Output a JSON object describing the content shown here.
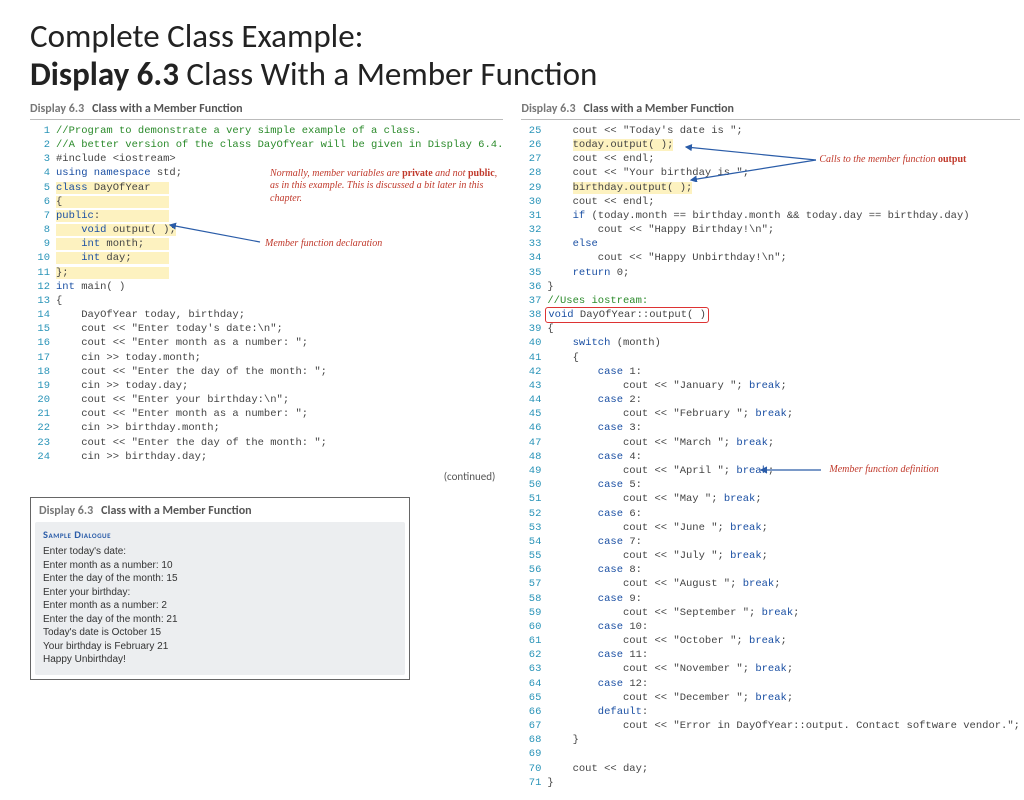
{
  "title_line1": "Complete Class Example:",
  "title_bold": "Display 6.3",
  "title_line2": "  Class With a Member Function",
  "caption_disp": "Display 6.3",
  "caption_text": "Class with a Member Function",
  "continued": "(continued)",
  "annotations": {
    "private_note_1": "Normally, member variables are ",
    "private_note_kw1": "private",
    "private_note_2": " and\nnot ",
    "private_note_kw2": "public",
    "private_note_3": ", as in this example. This is\ndiscussed a bit later in this chapter.",
    "decl": "Member function declaration",
    "calls_1": "Calls to the member function ",
    "calls_kw": "output",
    "defn": "Member function definition"
  },
  "code_left": [
    {
      "n": 1,
      "t": "//Program to demonstrate a very simple example of a class.",
      "cls": "cm"
    },
    {
      "n": 2,
      "t": "//A better version of the class DayOfYear will be given in Display 6.4.",
      "cls": "cm"
    },
    {
      "n": 3,
      "html": "<span class='txt'>#include &lt;iostream&gt;</span>"
    },
    {
      "n": 4,
      "html": "<span class='kw'>using namespace</span><span class='txt'> std;</span>"
    },
    {
      "n": 5,
      "html": "<span class='hl-yellow'><span class='kw'>class</span><span class='txt'> DayOfYear   </span></span>"
    },
    {
      "n": 6,
      "html": "<span class='hl-yellow'><span class='txt'>{                 </span></span>"
    },
    {
      "n": 7,
      "html": "<span class='hl-yellow'><span class='kw'>public</span><span class='txt'>:           </span></span>"
    },
    {
      "n": 8,
      "html": "<span class='hl-yellow'><span class='txt'>    </span><span class='kw'>void</span><span class='txt'> output( );</span></span>"
    },
    {
      "n": 9,
      "html": "<span class='hl-yellow'><span class='txt'>    </span><span class='kw'>int</span><span class='txt'> month;    </span></span>"
    },
    {
      "n": 10,
      "html": "<span class='hl-yellow'><span class='txt'>    </span><span class='kw'>int</span><span class='txt'> day;      </span></span>"
    },
    {
      "n": 11,
      "html": "<span class='hl-yellow'><span class='txt'>};                </span></span>"
    },
    {
      "n": 12,
      "html": "<span class='kw'>int</span><span class='txt'> main( )</span>"
    },
    {
      "n": 13,
      "t": "{",
      "cls": "txt"
    },
    {
      "n": 14,
      "t": "    DayOfYear today, birthday;",
      "cls": "txt"
    },
    {
      "n": 15,
      "t": "    cout << \"Enter today's date:\\n\";",
      "cls": "txt"
    },
    {
      "n": 16,
      "t": "    cout << \"Enter month as a number: \";",
      "cls": "txt"
    },
    {
      "n": 17,
      "t": "    cin >> today.month;",
      "cls": "txt"
    },
    {
      "n": 18,
      "t": "    cout << \"Enter the day of the month: \";",
      "cls": "txt"
    },
    {
      "n": 19,
      "t": "    cin >> today.day;",
      "cls": "txt"
    },
    {
      "n": 20,
      "t": "    cout << \"Enter your birthday:\\n\";",
      "cls": "txt"
    },
    {
      "n": 21,
      "t": "    cout << \"Enter month as a number: \";",
      "cls": "txt"
    },
    {
      "n": 22,
      "t": "    cin >> birthday.month;",
      "cls": "txt"
    },
    {
      "n": 23,
      "t": "    cout << \"Enter the day of the month: \";",
      "cls": "txt"
    },
    {
      "n": 24,
      "t": "    cin >> birthday.day;",
      "cls": "txt"
    }
  ],
  "code_right": [
    {
      "n": 25,
      "t": "    cout << \"Today's date is \";",
      "cls": "txt"
    },
    {
      "n": 26,
      "html": "<span class='txt'>    </span><span class='hl-yellow txt'>today.output( );</span>"
    },
    {
      "n": 27,
      "t": "    cout << endl;",
      "cls": "txt"
    },
    {
      "n": 28,
      "t": "    cout << \"Your birthday is \";",
      "cls": "txt"
    },
    {
      "n": 29,
      "html": "<span class='txt'>    </span><span class='hl-yellow txt'>birthday.output( );</span>"
    },
    {
      "n": 30,
      "t": "    cout << endl;",
      "cls": "txt"
    },
    {
      "n": 31,
      "html": "<span class='txt'>    </span><span class='kw'>if</span><span class='txt'> (today.month == birthday.month && today.day == birthday.day)</span>"
    },
    {
      "n": 32,
      "t": "        cout << \"Happy Birthday!\\n\";",
      "cls": "txt"
    },
    {
      "n": 33,
      "html": "<span class='txt'>    </span><span class='kw'>else</span>"
    },
    {
      "n": 34,
      "t": "        cout << \"Happy Unbirthday!\\n\";",
      "cls": "txt"
    },
    {
      "n": 35,
      "html": "<span class='txt'>    </span><span class='kw'>return</span><span class='txt'> 0;</span>"
    },
    {
      "n": 36,
      "t": "}",
      "cls": "txt"
    },
    {
      "n": 37,
      "t": "//Uses iostream:",
      "cls": "cm"
    },
    {
      "n": 38,
      "html": "<span class='hl-red'><span class='kw'>void</span><span class='txt'> DayOfYear::output( )</span></span>"
    },
    {
      "n": 39,
      "t": "{",
      "cls": "txt"
    },
    {
      "n": 40,
      "html": "<span class='txt'>    </span><span class='kw'>switch</span><span class='txt'> (month)</span>"
    },
    {
      "n": 41,
      "t": "    {",
      "cls": "txt"
    },
    {
      "n": 42,
      "html": "<span class='txt'>        </span><span class='kw'>case</span><span class='txt'> 1:</span>"
    },
    {
      "n": 43,
      "html": "<span class='txt'>            cout << \"January \"; </span><span class='kw'>break</span><span class='txt'>;</span>"
    },
    {
      "n": 44,
      "html": "<span class='txt'>        </span><span class='kw'>case</span><span class='txt'> 2:</span>"
    },
    {
      "n": 45,
      "html": "<span class='txt'>            cout << \"February \"; </span><span class='kw'>break</span><span class='txt'>;</span>"
    },
    {
      "n": 46,
      "html": "<span class='txt'>        </span><span class='kw'>case</span><span class='txt'> 3:</span>"
    },
    {
      "n": 47,
      "html": "<span class='txt'>            cout << \"March \"; </span><span class='kw'>break</span><span class='txt'>;</span>"
    },
    {
      "n": 48,
      "html": "<span class='txt'>        </span><span class='kw'>case</span><span class='txt'> 4:</span>"
    },
    {
      "n": 49,
      "html": "<span class='txt'>            cout << \"April \"; </span><span class='kw'>break</span><span class='txt'>;</span>"
    },
    {
      "n": 50,
      "html": "<span class='txt'>        </span><span class='kw'>case</span><span class='txt'> 5:</span>"
    },
    {
      "n": 51,
      "html": "<span class='txt'>            cout << \"May \"; </span><span class='kw'>break</span><span class='txt'>;</span>"
    },
    {
      "n": 52,
      "html": "<span class='txt'>        </span><span class='kw'>case</span><span class='txt'> 6:</span>"
    },
    {
      "n": 53,
      "html": "<span class='txt'>            cout << \"June \"; </span><span class='kw'>break</span><span class='txt'>;</span>"
    },
    {
      "n": 54,
      "html": "<span class='txt'>        </span><span class='kw'>case</span><span class='txt'> 7:</span>"
    },
    {
      "n": 55,
      "html": "<span class='txt'>            cout << \"July \"; </span><span class='kw'>break</span><span class='txt'>;</span>"
    },
    {
      "n": 56,
      "html": "<span class='txt'>        </span><span class='kw'>case</span><span class='txt'> 8:</span>"
    },
    {
      "n": 57,
      "html": "<span class='txt'>            cout << \"August \"; </span><span class='kw'>break</span><span class='txt'>;</span>"
    },
    {
      "n": 58,
      "html": "<span class='txt'>        </span><span class='kw'>case</span><span class='txt'> 9:</span>"
    },
    {
      "n": 59,
      "html": "<span class='txt'>            cout << \"September \"; </span><span class='kw'>break</span><span class='txt'>;</span>"
    },
    {
      "n": 60,
      "html": "<span class='txt'>        </span><span class='kw'>case</span><span class='txt'> 10:</span>"
    },
    {
      "n": 61,
      "html": "<span class='txt'>            cout << \"October \"; </span><span class='kw'>break</span><span class='txt'>;</span>"
    },
    {
      "n": 62,
      "html": "<span class='txt'>        </span><span class='kw'>case</span><span class='txt'> 11:</span>"
    },
    {
      "n": 63,
      "html": "<span class='txt'>            cout << \"November \"; </span><span class='kw'>break</span><span class='txt'>;</span>"
    },
    {
      "n": 64,
      "html": "<span class='txt'>        </span><span class='kw'>case</span><span class='txt'> 12:</span>"
    },
    {
      "n": 65,
      "html": "<span class='txt'>            cout << \"December \"; </span><span class='kw'>break</span><span class='txt'>;</span>"
    },
    {
      "n": 66,
      "html": "<span class='txt'>        </span><span class='kw'>default</span><span class='txt'>:</span>"
    },
    {
      "n": 67,
      "t": "            cout << \"Error in DayOfYear::output. Contact software vendor.\";",
      "cls": "txt"
    },
    {
      "n": 68,
      "t": "    }",
      "cls": "txt"
    },
    {
      "n": 69,
      "t": "",
      "cls": "txt"
    },
    {
      "n": 70,
      "t": "    cout << day;",
      "cls": "txt"
    },
    {
      "n": 71,
      "t": "}",
      "cls": "txt"
    }
  ],
  "sample": {
    "title": "Sample Dialogue",
    "body": "Enter today's date:\nEnter month as a number: 10\nEnter the day of the month: 15\nEnter your birthday:\nEnter month as a number: 2\nEnter the day of the month: 21\nToday's date is October 15\nYour birthday is February 21\nHappy Unbirthday!"
  }
}
